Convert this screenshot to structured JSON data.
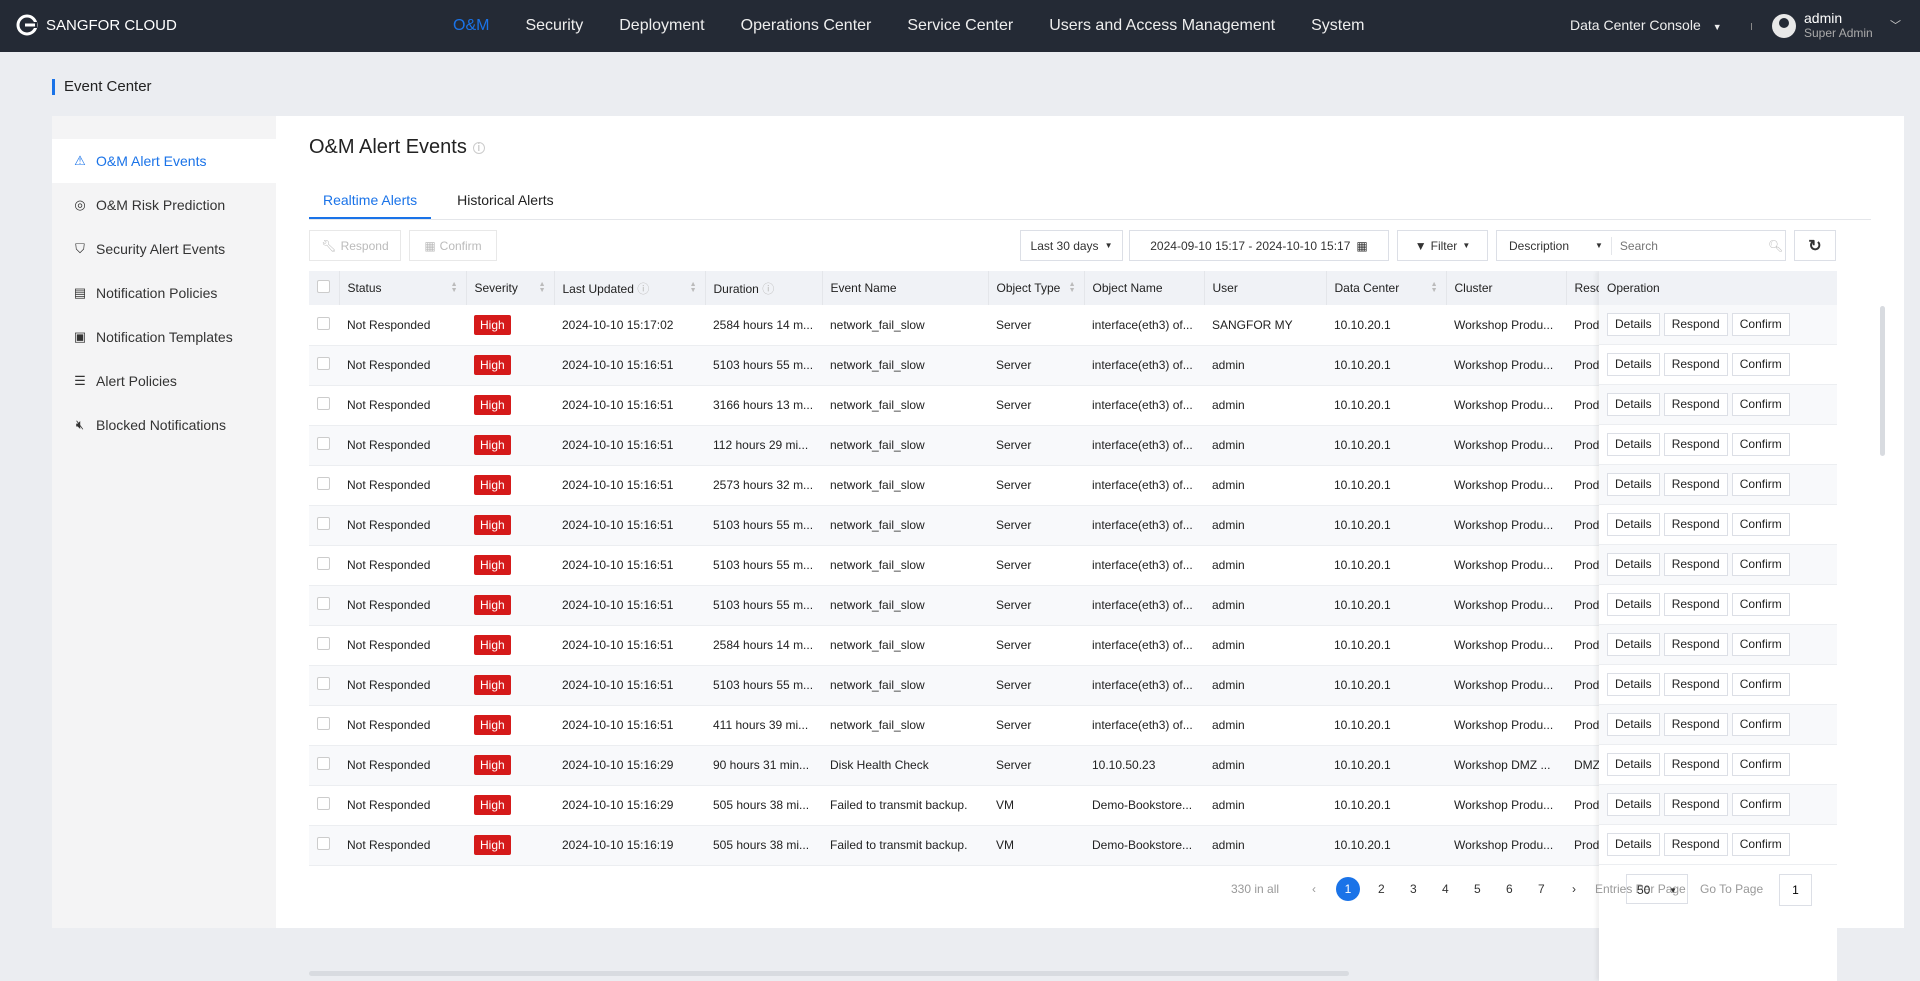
{
  "header": {
    "brand": "SANGFOR CLOUD",
    "menu": [
      "O&M",
      "Security",
      "Deployment",
      "Operations Center",
      "Service Center",
      "Users and Access Management",
      "System"
    ],
    "active_menu": "O&M",
    "console": "Data Center Console",
    "user": "admin",
    "role": "Super Admin"
  },
  "breadcrumb": "Event Center",
  "sidebar": {
    "items": [
      {
        "label": "O&M Alert Events",
        "icon": "warning-icon"
      },
      {
        "label": "O&M Risk Prediction",
        "icon": "pulse-icon"
      },
      {
        "label": "Security Alert Events",
        "icon": "shield-icon"
      },
      {
        "label": "Notification Policies",
        "icon": "policy-icon"
      },
      {
        "label": "Notification Templates",
        "icon": "template-icon"
      },
      {
        "label": "Alert Policies",
        "icon": "clipboard-icon"
      },
      {
        "label": "Blocked Notifications",
        "icon": "mute-icon"
      }
    ]
  },
  "page": {
    "title": "O&M Alert Events",
    "tabs": [
      "Realtime Alerts",
      "Historical Alerts"
    ]
  },
  "toolbar": {
    "respond": "Respond",
    "confirm": "Confirm",
    "range": "Last 30 days",
    "dates": "2024-09-10 15:17 - 2024-10-10 15:17",
    "filter": "Filter",
    "field": "Description",
    "search_placeholder": "Search"
  },
  "table": {
    "columns": [
      "Status",
      "Severity",
      "Last Updated",
      "Duration",
      "Event Name",
      "Object Type",
      "Object Name",
      "User",
      "Data Center",
      "Cluster",
      "Resou"
    ],
    "operation": "Operation",
    "op_buttons": [
      "Details",
      "Respond",
      "Confirm"
    ],
    "rows": [
      [
        "Not Responded",
        "High",
        "2024-10-10 15:17:02",
        "2584 hours 14 m...",
        "network_fail_slow",
        "Server",
        "interface(eth3) of...",
        "SANGFOR MY",
        "10.10.20.1",
        "Workshop Produ...",
        "Produ"
      ],
      [
        "Not Responded",
        "High",
        "2024-10-10 15:16:51",
        "5103 hours 55 m...",
        "network_fail_slow",
        "Server",
        "interface(eth3) of...",
        "admin",
        "10.10.20.1",
        "Workshop Produ...",
        "Produ"
      ],
      [
        "Not Responded",
        "High",
        "2024-10-10 15:16:51",
        "3166 hours 13 m...",
        "network_fail_slow",
        "Server",
        "interface(eth3) of...",
        "admin",
        "10.10.20.1",
        "Workshop Produ...",
        "Produ"
      ],
      [
        "Not Responded",
        "High",
        "2024-10-10 15:16:51",
        "112 hours 29 mi...",
        "network_fail_slow",
        "Server",
        "interface(eth3) of...",
        "admin",
        "10.10.20.1",
        "Workshop Produ...",
        "Produ"
      ],
      [
        "Not Responded",
        "High",
        "2024-10-10 15:16:51",
        "2573 hours 32 m...",
        "network_fail_slow",
        "Server",
        "interface(eth3) of...",
        "admin",
        "10.10.20.1",
        "Workshop Produ...",
        "Produ"
      ],
      [
        "Not Responded",
        "High",
        "2024-10-10 15:16:51",
        "5103 hours 55 m...",
        "network_fail_slow",
        "Server",
        "interface(eth3) of...",
        "admin",
        "10.10.20.1",
        "Workshop Produ...",
        "Produ"
      ],
      [
        "Not Responded",
        "High",
        "2024-10-10 15:16:51",
        "5103 hours 55 m...",
        "network_fail_slow",
        "Server",
        "interface(eth3) of...",
        "admin",
        "10.10.20.1",
        "Workshop Produ...",
        "Produ"
      ],
      [
        "Not Responded",
        "High",
        "2024-10-10 15:16:51",
        "5103 hours 55 m...",
        "network_fail_slow",
        "Server",
        "interface(eth3) of...",
        "admin",
        "10.10.20.1",
        "Workshop Produ...",
        "Produ"
      ],
      [
        "Not Responded",
        "High",
        "2024-10-10 15:16:51",
        "2584 hours 14 m...",
        "network_fail_slow",
        "Server",
        "interface(eth3) of...",
        "admin",
        "10.10.20.1",
        "Workshop Produ...",
        "Produ"
      ],
      [
        "Not Responded",
        "High",
        "2024-10-10 15:16:51",
        "5103 hours 55 m...",
        "network_fail_slow",
        "Server",
        "interface(eth3) of...",
        "admin",
        "10.10.20.1",
        "Workshop Produ...",
        "Produ"
      ],
      [
        "Not Responded",
        "High",
        "2024-10-10 15:16:51",
        "411 hours 39 mi...",
        "network_fail_slow",
        "Server",
        "interface(eth3) of...",
        "admin",
        "10.10.20.1",
        "Workshop Produ...",
        "Produ"
      ],
      [
        "Not Responded",
        "High",
        "2024-10-10 15:16:29",
        "90 hours 31 min...",
        "Disk Health Check",
        "Server",
        "10.10.50.23",
        "admin",
        "10.10.20.1",
        "Workshop DMZ ...",
        "DMZ F"
      ],
      [
        "Not Responded",
        "High",
        "2024-10-10 15:16:29",
        "505 hours 38 mi...",
        "Failed to transmit backup.",
        "VM",
        "Demo-Bookstore...",
        "admin",
        "10.10.20.1",
        "Workshop Produ...",
        "Produ"
      ],
      [
        "Not Responded",
        "High",
        "2024-10-10 15:16:19",
        "505 hours 38 mi...",
        "Failed to transmit backup.",
        "VM",
        "Demo-Bookstore...",
        "admin",
        "10.10.20.1",
        "Workshop Produ...",
        "Produ"
      ]
    ]
  },
  "pagination": {
    "total": "330 in all",
    "pages": [
      "1",
      "2",
      "3",
      "4",
      "5",
      "6",
      "7"
    ],
    "current": "1",
    "per_page_label": "Entries Per Page",
    "per_page": "50",
    "goto_label": "Go To Page",
    "goto": "1"
  },
  "colors": {
    "accent": "#1a73e8",
    "nav": "#242a35",
    "severity_high": "#d51a1a"
  }
}
